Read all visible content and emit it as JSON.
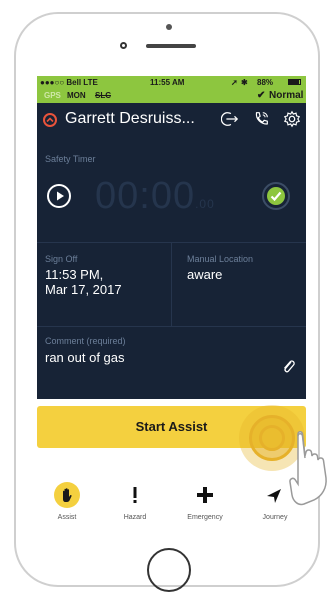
{
  "status_bar": {
    "carrier": "●●●○○ Bell  LTE",
    "time": "11:55 AM",
    "battery": "88%",
    "battery_level": 0.88
  },
  "sub_status": {
    "gps": "GPS",
    "day": "MON",
    "slc": "SLC",
    "mode": "Normal"
  },
  "header": {
    "name": "Garrett Desruiss..."
  },
  "safety_timer": {
    "label": "Safety Timer",
    "time": "00:00",
    "fraction": ".00"
  },
  "sign_off": {
    "label": "Sign Off",
    "value_line1": "11:53 PM,",
    "value_line2": "Mar 17, 2017"
  },
  "manual_location": {
    "label": "Manual Location",
    "value": "aware"
  },
  "comment": {
    "label": "Comment (required)",
    "value": "ran out of gas"
  },
  "primary_button": {
    "label": "Start Assist"
  },
  "tabs": [
    {
      "label": "Assist",
      "icon": "hand-icon"
    },
    {
      "label": "Hazard",
      "icon": "exclamation-icon"
    },
    {
      "label": "Emergency",
      "icon": "plus-icon"
    },
    {
      "label": "Journey",
      "icon": "arrow-icon"
    }
  ],
  "colors": {
    "status_green": "#8dc63f",
    "panel_navy": "#172336",
    "accent_yellow": "#f4d03f",
    "alert_red": "#e8533b",
    "check_green": "#8dc63f"
  }
}
